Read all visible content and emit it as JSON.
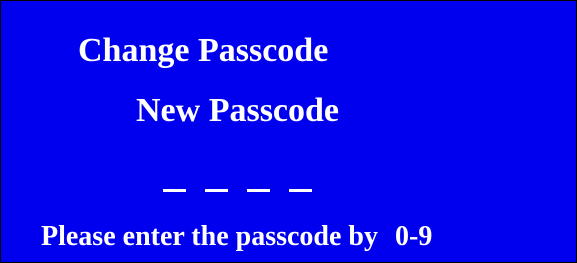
{
  "screen": {
    "title": "Change Passcode",
    "subtitle": "New Passcode",
    "digit_slots": 4,
    "prompt_text": "Please enter the passcode by",
    "prompt_range": "0-9",
    "colors": {
      "background": "#0000ee",
      "text": "#ffffff"
    }
  }
}
